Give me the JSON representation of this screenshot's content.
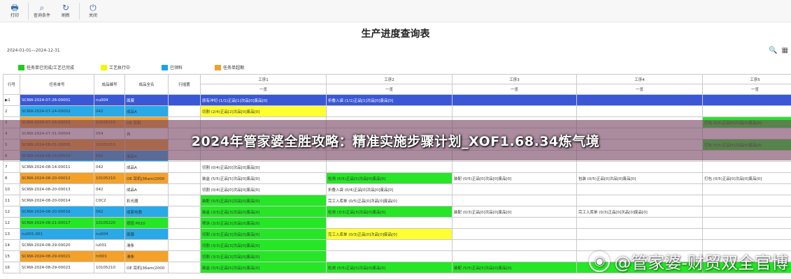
{
  "toolbar": {
    "buttons": [
      {
        "label": "打印",
        "icon": "printer-icon"
      },
      {
        "label": "查询条件",
        "icon": "search-condition-icon"
      },
      {
        "label": "刷新",
        "icon": "refresh-icon"
      },
      {
        "label": "关闭",
        "icon": "power-icon"
      }
    ]
  },
  "page": {
    "title": "生产进度查询表",
    "date_range": "2024-01-01—2024-12-31"
  },
  "legend": [
    {
      "label": "任务单已完成/工艺已完成",
      "color": "#22cc22"
    },
    {
      "label": "工艺执行中",
      "color": "#f5f500"
    },
    {
      "label": "已领料",
      "color": "#1aa3e8"
    },
    {
      "label": "任务单超期",
      "color": "#f0a030"
    }
  ],
  "colors": {
    "green": "#27e627",
    "yellow": "#ffff33",
    "blue": "#29a9e8",
    "orange": "#f4a12a",
    "selected": "#3a57d6"
  },
  "table": {
    "headers": {
      "index": "行号",
      "task_no": "任务单号",
      "product_code": "成品编号",
      "product_name": "成品全名",
      "bom": "行插罢",
      "processes": [
        "工序1",
        "工序2",
        "工序3",
        "工序4",
        "工序5"
      ],
      "overview": "一览"
    },
    "rows": [
      {
        "idx": "1",
        "task": "SCRW-2024-07-26-00001",
        "code": "nu004",
        "name": "面膜",
        "bom": "",
        "row_color": "selected",
        "p": [
          {
            "t": "原有冲切 (1/1)正品[1]次品[0]废品[0]",
            "c": "selected"
          },
          {
            "t": "折叠入袋 (1/1)正品[1]次品[0]废品[0]",
            "c": "selected"
          },
          {
            "t": "",
            "c": "selected"
          },
          {
            "t": "",
            "c": "selected"
          },
          {
            "t": "",
            "c": "selected"
          }
        ]
      },
      {
        "idx": "2",
        "task": "SCRW-2024-07-24-00002",
        "code": "042",
        "name": "成品A",
        "bom": "",
        "row_color": "blue",
        "p": [
          {
            "t": "切割 (2/4)正品[2]次品[0]废品[0]",
            "c": "yellow"
          },
          {
            "t": "",
            "c": ""
          },
          {
            "t": "",
            "c": ""
          },
          {
            "t": "",
            "c": ""
          },
          {
            "t": "",
            "c": ""
          }
        ]
      },
      {
        "idx": "3",
        "task": "SCRW-2024-07-26-00003",
        "code": "10105210",
        "name": "OE 耳机",
        "bom": "",
        "row_color": "orange",
        "p": [
          {
            "t": "",
            "c": ""
          },
          {
            "t": "",
            "c": ""
          },
          {
            "t": "",
            "c": ""
          },
          {
            "t": "",
            "c": ""
          },
          {
            "t": "打包 (5/5)正品[5]次品[0]废品[0]",
            "c": "green"
          }
        ]
      },
      {
        "idx": "4",
        "task": "SCRW-2024-07-31-00004",
        "code": "054",
        "name": "自",
        "bom": "",
        "row_color": "",
        "p": [
          {
            "t": "",
            "c": ""
          },
          {
            "t": "",
            "c": ""
          },
          {
            "t": "",
            "c": ""
          },
          {
            "t": "",
            "c": ""
          },
          {
            "t": "",
            "c": ""
          }
        ]
      },
      {
        "idx": "5",
        "task": "SCRW-2024-08-01-00005",
        "code": "10105210",
        "name": "",
        "bom": "",
        "row_color": "orange",
        "p": [
          {
            "t": "",
            "c": ""
          },
          {
            "t": "",
            "c": ""
          },
          {
            "t": "",
            "c": ""
          },
          {
            "t": "",
            "c": ""
          },
          {
            "t": "打包 (5/5)正品[5]次品[0]废品[0]",
            "c": "green"
          }
        ]
      },
      {
        "idx": "6",
        "task": "SCRW-2024-08-14-00010",
        "code": "042",
        "name": "成品A",
        "bom": "",
        "row_color": "blue",
        "p": [
          {
            "t": "",
            "c": ""
          },
          {
            "t": "",
            "c": ""
          },
          {
            "t": "",
            "c": ""
          },
          {
            "t": "",
            "c": ""
          },
          {
            "t": "",
            "c": ""
          }
        ]
      },
      {
        "idx": "7",
        "task": "SCRW-2024-08-14-00011",
        "code": "042",
        "name": "成品A",
        "bom": "",
        "row_color": "",
        "p": [
          {
            "t": "切割 (0/4)正品[0]次品[0]废品[0]",
            "c": ""
          },
          {
            "t": "",
            "c": ""
          },
          {
            "t": "",
            "c": ""
          },
          {
            "t": "",
            "c": ""
          },
          {
            "t": "",
            "c": ""
          }
        ]
      },
      {
        "idx": "8",
        "task": "SCRW-2024-08-20-00012",
        "code": "10105210",
        "name": "OE 耳机|36am(2000",
        "bom": "",
        "row_color": "orange",
        "p": [
          {
            "t": "装盒 (5/5)正品[5]次品[0]废品[0]",
            "c": ""
          },
          {
            "t": "检测 (5/5)正品[5]次品[0]废品[0]",
            "c": "green"
          },
          {
            "t": "装配 (0/5)正品[0]次品[0]废品[0]",
            "c": ""
          },
          {
            "t": "包装 (0/5)正品[0]次品[0]废品[0]",
            "c": ""
          },
          {
            "t": "打包 (0/5)正品[0]次品[0]废品[0]",
            "c": ""
          }
        ]
      },
      {
        "idx": "10",
        "task": "SCRW-2024-08-20-00013",
        "code": "042",
        "name": "成品A",
        "bom": "",
        "row_color": "",
        "p": [
          {
            "t": "切割 (0/4)正品[0]次品[0]废品[0]",
            "c": ""
          },
          {
            "t": "折叠入袋 (0/4)正品[0]次品[0]废品[0]",
            "c": ""
          },
          {
            "t": "",
            "c": ""
          },
          {
            "t": "",
            "c": ""
          },
          {
            "t": "",
            "c": ""
          }
        ]
      },
      {
        "idx": "11",
        "task": "SCRW-2024-08-20-00014",
        "code": "C0C2",
        "name": "彩光器",
        "bom": "",
        "row_color": "",
        "p": [
          {
            "t": "装配 (5/5)正品[5]次品[0]废品[0]",
            "c": "green"
          },
          {
            "t": "完工入库单 (0/5)正品[0]次品[0]废品[0]",
            "c": ""
          },
          {
            "t": "",
            "c": ""
          },
          {
            "t": "",
            "c": ""
          },
          {
            "t": "",
            "c": ""
          }
        ]
      },
      {
        "idx": "12",
        "task": "SCRW-2024-08-20-00016",
        "code": "062",
        "name": "成套电器",
        "bom": "",
        "row_color": "blue",
        "p": [
          {
            "t": "装盒 (3/3)正品[3]次品[0]废品[0]",
            "c": "green"
          },
          {
            "t": "检测 (3/3)正品[3]次品[0]废品[0]",
            "c": "green"
          },
          {
            "t": "装配 (0/3)正品[0]次品[0]废品[0]",
            "c": ""
          },
          {
            "t": "完工入库单 (0/3)正品[0]次品[0]废品[0]",
            "c": ""
          },
          {
            "t": "",
            "c": ""
          }
        ]
      },
      {
        "idx": "12",
        "task": "SCRW-2024-08-21-00017",
        "code": "10105220",
        "name": "按钮 P610",
        "bom": "",
        "row_color": "green",
        "p": [
          {
            "t": "喷涂 (3/3)正品[3]次品[0]废品[0]",
            "c": "green"
          },
          {
            "t": "",
            "c": ""
          },
          {
            "t": "",
            "c": ""
          },
          {
            "t": "",
            "c": ""
          },
          {
            "t": "",
            "c": ""
          }
        ]
      },
      {
        "idx": "13",
        "task": "nu001-001",
        "code": "nu004",
        "name": "面膜",
        "bom": "",
        "row_color": "blue",
        "p": [
          {
            "t": "切割 (3/3)正品[3]次品[0]废品[0]",
            "c": "green"
          },
          {
            "t": "完工入库单 (0/3)正品[0]次品[0]废品[0]",
            "c": "yellow"
          },
          {
            "t": "",
            "c": ""
          },
          {
            "t": "",
            "c": ""
          },
          {
            "t": "",
            "c": ""
          }
        ]
      },
      {
        "idx": "14",
        "task": "SCRW-2024-08-29-00020",
        "code": "lu001",
        "name": "滑条",
        "bom": "",
        "row_color": "",
        "p": [
          {
            "t": "切割 (3/3)正品[3]次品[0]废品[0]",
            "c": "green"
          },
          {
            "t": "",
            "c": ""
          },
          {
            "t": "",
            "c": ""
          },
          {
            "t": "",
            "c": ""
          },
          {
            "t": "",
            "c": ""
          }
        ]
      },
      {
        "idx": "15",
        "task": "SCRW-2024-08-29-00021",
        "code": "ht001",
        "name": "滑条",
        "bom": "",
        "row_color": "orange",
        "p": [
          {
            "t": "切割 (3/3)正品[3]次品[0]废品[0]",
            "c": "green"
          },
          {
            "t": "",
            "c": ""
          },
          {
            "t": "",
            "c": ""
          },
          {
            "t": "",
            "c": ""
          },
          {
            "t": "",
            "c": ""
          }
        ]
      },
      {
        "idx": "16",
        "task": "SCRW-2024-08-29-00023",
        "code": "10105210",
        "name": "OE 耳机|36am(2000",
        "bom": "",
        "row_color": "",
        "p": [
          {
            "t": "装盒 (5/5)正品[5]次品[0]废品[0]",
            "c": "green"
          },
          {
            "t": "检测 (5/5)正品[5]次品[0]废品[0]",
            "c": "green"
          },
          {
            "t": "装配 (5/5)正品[5]次品[0]废品[0]",
            "c": "green"
          },
          {
            "t": "",
            "c": "green"
          },
          {
            "t": "",
            "c": "green"
          }
        ]
      }
    ]
  },
  "banner": {
    "text": "2024年管家婆全胜攻略：精准实施步骤计划_XOF1.68.34炼气境"
  },
  "mark": {
    "text": "@管家婆-财贸双全官博"
  }
}
